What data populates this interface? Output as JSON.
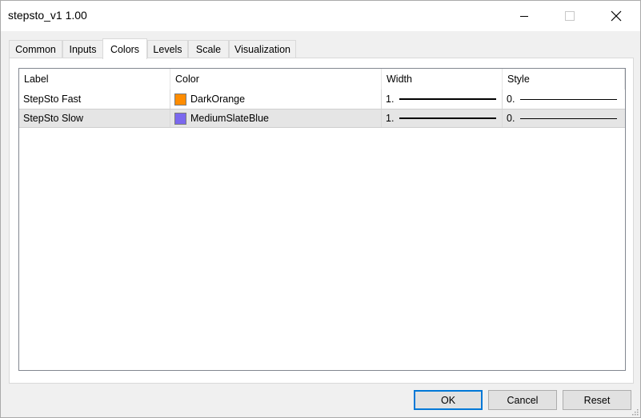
{
  "window": {
    "title": "stepsto_v1 1.00"
  },
  "tabs": [
    {
      "label": "Common"
    },
    {
      "label": "Inputs"
    },
    {
      "label": "Colors"
    },
    {
      "label": "Levels"
    },
    {
      "label": "Scale"
    },
    {
      "label": "Visualization"
    }
  ],
  "active_tab": "Colors",
  "table": {
    "columns": [
      "Label",
      "Color",
      "Width",
      "Style"
    ],
    "rows": [
      {
        "label": "StepSto Fast",
        "color_name": "DarkOrange",
        "color": "#ff8c00",
        "width": "1.",
        "style": "0."
      },
      {
        "label": "StepSto Slow",
        "color_name": "MediumSlateBlue",
        "color": "#7b68ee",
        "width": "1.",
        "style": "0."
      }
    ]
  },
  "buttons": {
    "ok": "OK",
    "cancel": "Cancel",
    "reset": "Reset"
  },
  "accent": "#0078d7"
}
